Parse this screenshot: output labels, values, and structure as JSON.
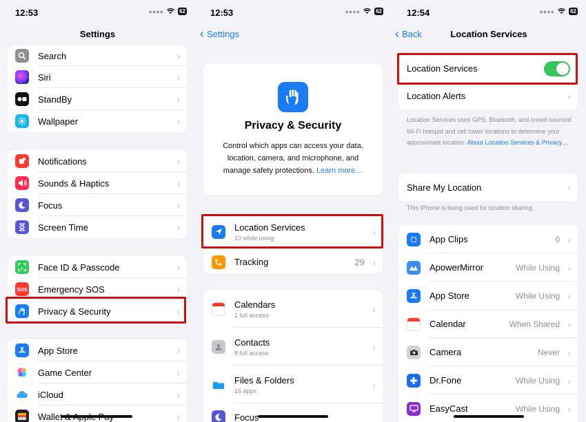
{
  "status": [
    {
      "time": "12:53",
      "battery": "62"
    },
    {
      "time": "12:53",
      "battery": "62"
    },
    {
      "time": "12:54",
      "battery": "62"
    }
  ],
  "settings": {
    "title": "Settings",
    "group1": [
      {
        "label": "Search",
        "icon": "search-icon"
      },
      {
        "label": "Siri",
        "icon": "siri-icon"
      },
      {
        "label": "StandBy",
        "icon": "standby-icon"
      },
      {
        "label": "Wallpaper",
        "icon": "wallpaper-icon"
      }
    ],
    "group2": [
      {
        "label": "Notifications",
        "icon": "bell-icon"
      },
      {
        "label": "Sounds & Haptics",
        "icon": "speaker-icon"
      },
      {
        "label": "Focus",
        "icon": "moon-icon"
      },
      {
        "label": "Screen Time",
        "icon": "hourglass-icon"
      }
    ],
    "group3": [
      {
        "label": "Face ID & Passcode",
        "icon": "face-id-icon"
      },
      {
        "label": "Emergency SOS",
        "icon": "sos-icon",
        "icon_text": "SOS"
      },
      {
        "label": "Privacy & Security",
        "icon": "hand-icon"
      }
    ],
    "group4": [
      {
        "label": "App Store",
        "icon": "app-store-icon"
      },
      {
        "label": "Game Center",
        "icon": "game-center-icon"
      },
      {
        "label": "iCloud",
        "icon": "cloud-icon"
      },
      {
        "label": "Wallet & Apple Pay",
        "icon": "wallet-icon"
      }
    ]
  },
  "privacy": {
    "back": "Settings",
    "header_title": "Privacy & Security",
    "header_desc": "Control which apps can access your data, location, camera, and microphone, and manage safety protections.",
    "learn_more": "Learn more…",
    "location": {
      "label": "Location Services",
      "sub": "10 while using"
    },
    "tracking": {
      "label": "Tracking",
      "value": "29"
    },
    "items": [
      {
        "label": "Calendars",
        "sub": "1 full access",
        "icon": "calendar-icon"
      },
      {
        "label": "Contacts",
        "sub": "8 full access",
        "icon": "contacts-icon"
      },
      {
        "label": "Files & Folders",
        "sub": "16 apps",
        "icon": "folder-icon"
      },
      {
        "label": "Focus",
        "sub": "",
        "icon": "moon-icon"
      }
    ]
  },
  "location": {
    "back": "Back",
    "title": "Location Services",
    "toggle_label": "Location Services",
    "toggle_on": true,
    "alerts": "Location Alerts",
    "footnote": "Location Services uses GPS, Bluetooth, and crowd-sourced Wi-Fi hotspot and cell tower locations to determine your approximate location.",
    "footnote_link": "About Location Services & Privacy…",
    "share": "Share My Location",
    "share_note": "This iPhone is being used for location sharing.",
    "apps": [
      {
        "label": "App Clips",
        "value": "0",
        "icon": "app-clips-icon"
      },
      {
        "label": "ApowerMirror",
        "value": "While Using",
        "icon": "apowermirror-icon"
      },
      {
        "label": "App Store",
        "value": "While Using",
        "icon": "app-store-icon"
      },
      {
        "label": "Calendar",
        "value": "When Shared",
        "icon": "calendar-icon"
      },
      {
        "label": "Camera",
        "value": "Never",
        "icon": "camera-icon"
      },
      {
        "label": "Dr.Fone",
        "value": "While Using",
        "icon": "drfone-icon"
      },
      {
        "label": "EasyCast",
        "value": "While Using",
        "icon": "easycast-icon"
      }
    ]
  }
}
